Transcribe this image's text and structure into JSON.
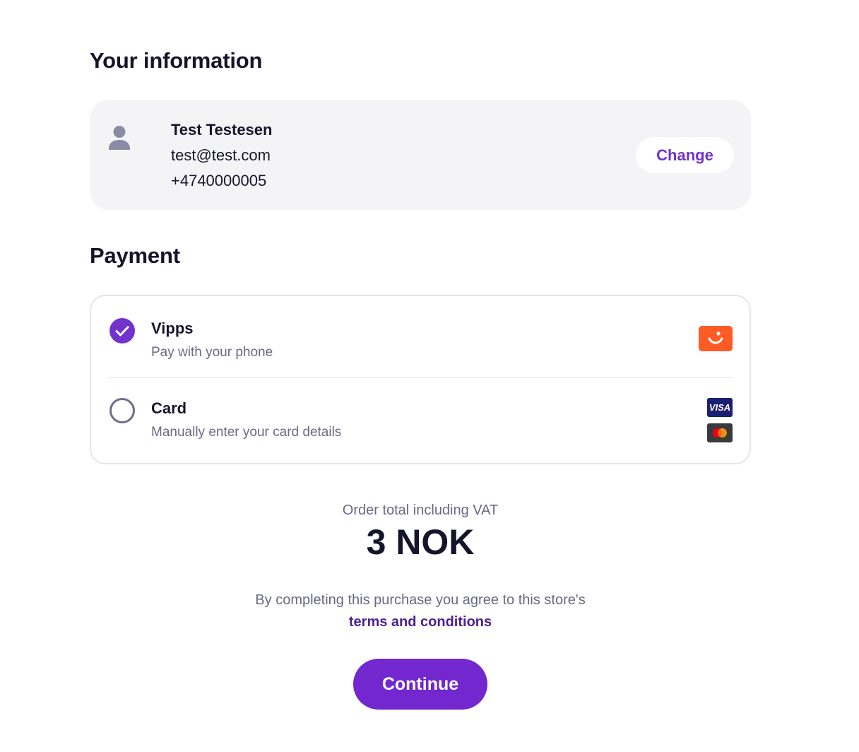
{
  "your_information": {
    "title": "Your information",
    "name": "Test Testesen",
    "email": "test@test.com",
    "phone": "+4740000005",
    "change_label": "Change",
    "icon": "person-icon"
  },
  "payment": {
    "title": "Payment",
    "options": [
      {
        "label": "Vipps",
        "description": "Pay with your phone",
        "selected": true,
        "icons": [
          "vipps-logo-icon"
        ]
      },
      {
        "label": "Card",
        "description": "Manually enter your card details",
        "selected": false,
        "icons": [
          "visa-logo-icon",
          "mastercard-logo-icon"
        ],
        "visa_text": "VISA"
      }
    ]
  },
  "order": {
    "total_label": "Order total including VAT",
    "total_value": "3 NOK"
  },
  "legal": {
    "agree_text": "By completing this purchase you agree to this store's",
    "terms_link": "terms and conditions"
  },
  "continue_label": "Continue",
  "colors": {
    "accent": "#7232cc",
    "vipps_orange": "#ff5b24",
    "visa_blue": "#1a1f71",
    "card_background": "#f4f4f7"
  }
}
